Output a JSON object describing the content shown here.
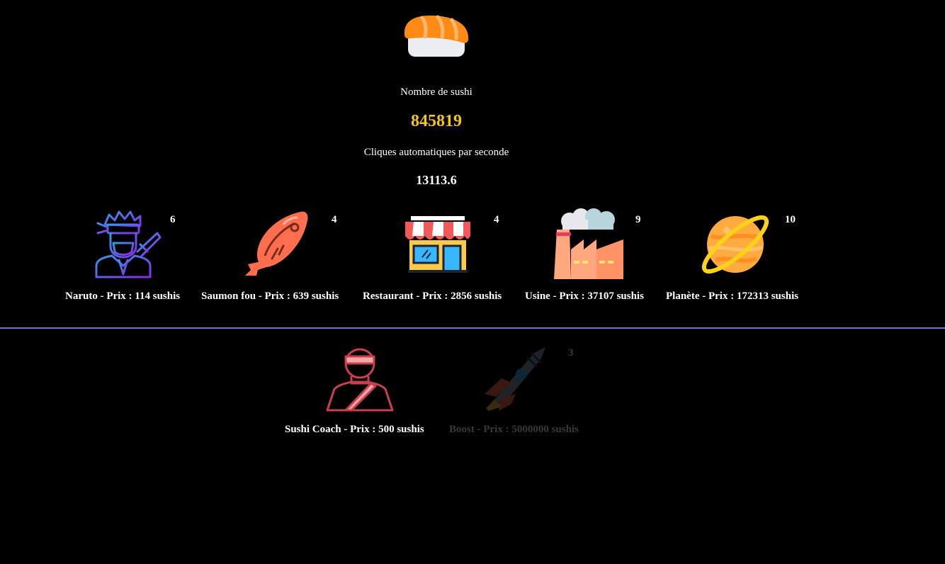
{
  "counters": {
    "sushi_label": "Nombre de sushi",
    "sushi_count": "845819",
    "cps_label": "Cliques automatiques par seconde",
    "cps_count": "13113.6"
  },
  "producers": [
    {
      "name": "Naruto - Prix : 114 sushis",
      "owned": "6",
      "icon": "ninja-icon"
    },
    {
      "name": "Saumon fou - Prix : 639 sushis",
      "owned": "4",
      "icon": "salmon-icon"
    },
    {
      "name": "Restaurant - Prix : 2856 sushis",
      "owned": "4",
      "icon": "restaurant-icon"
    },
    {
      "name": "Usine - Prix : 37107 sushis",
      "owned": "9",
      "icon": "factory-icon"
    },
    {
      "name": "Planète - Prix : 172313 sushis",
      "owned": "10",
      "icon": "planet-icon"
    }
  ],
  "upgrades": [
    {
      "name": "Sushi Coach - Prix : 500 sushis",
      "owned": "",
      "icon": "chef-icon",
      "enabled": true
    },
    {
      "name": "Boost - Prix : 5000000 sushis",
      "owned": "3",
      "icon": "rocket-icon",
      "enabled": false
    }
  ],
  "colors": {
    "background": "#000000",
    "count_accent": "#f5c518",
    "divider": "#8a67c9"
  }
}
